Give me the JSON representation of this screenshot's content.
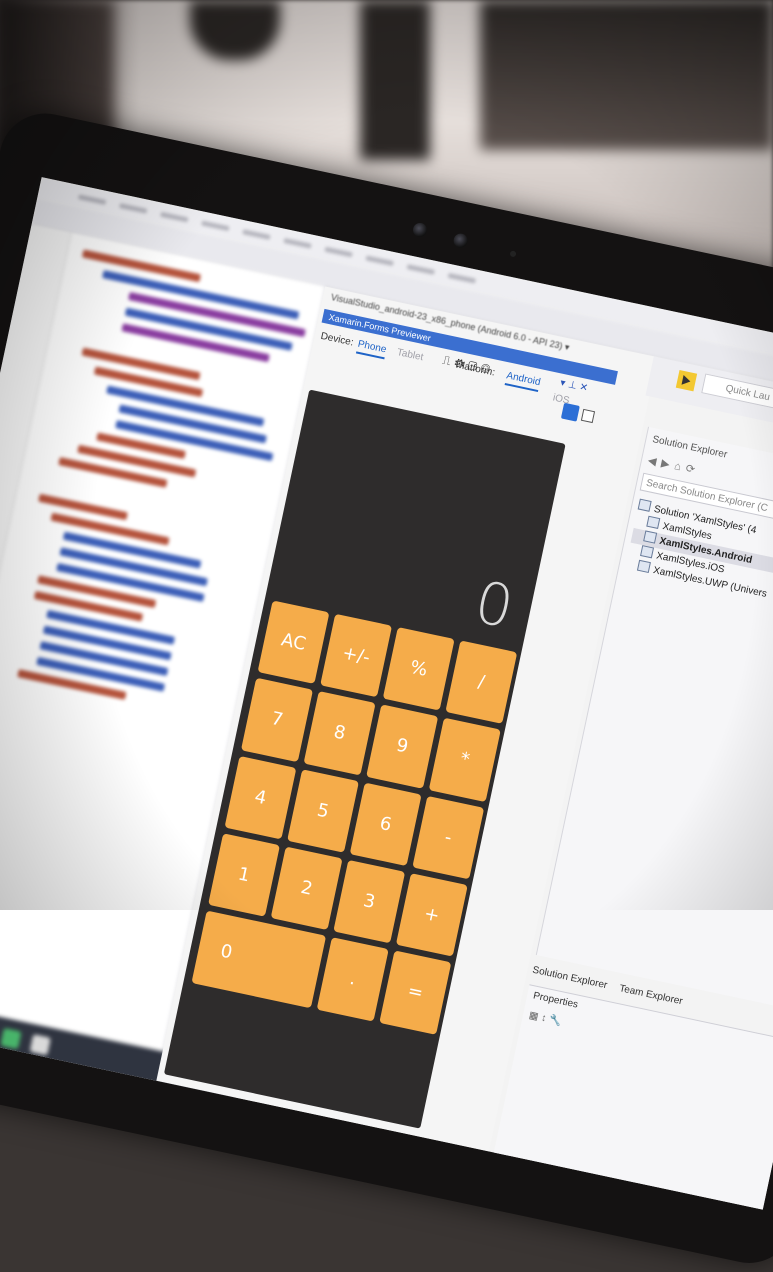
{
  "previewer": {
    "path": "VisualStudio_android-23_x86_phone (Android 6.0 - API 23) ▾",
    "title": "Xamarin.Forms Previewer",
    "device_label": "Device:",
    "tab_phone": "Phone",
    "tab_tablet": "Tablet",
    "platform_label": "Platform:",
    "tab_android": "Android",
    "tab_ios": "iOS"
  },
  "calculator": {
    "display": "0",
    "keys": [
      "AC",
      "+/-",
      "%",
      "/",
      "7",
      "8",
      "9",
      "*",
      "4",
      "5",
      "6",
      "-",
      "1",
      "2",
      "3",
      "+",
      "0",
      ".",
      "="
    ]
  },
  "toolbar": {
    "quick_launch_placeholder": "Quick Lau"
  },
  "solution_explorer": {
    "header": "Solution Explorer",
    "search_placeholder": "Search Solution Explorer (C",
    "items": [
      {
        "label": "Solution 'XamlStyles' (4"
      },
      {
        "label": "XamlStyles"
      },
      {
        "label": "XamlStyles.Android"
      },
      {
        "label": "XamlStyles.iOS"
      },
      {
        "label": "XamlStyles.UWP (Univers"
      }
    ],
    "bottom_tabs": [
      "Solution Explorer",
      "Team Explorer"
    ]
  },
  "properties": {
    "title": "Properties"
  },
  "colors": {
    "key_orange": "#f5ac4a",
    "phone_bg": "#2e2c2c",
    "accent_blue": "#3b6fd0"
  }
}
